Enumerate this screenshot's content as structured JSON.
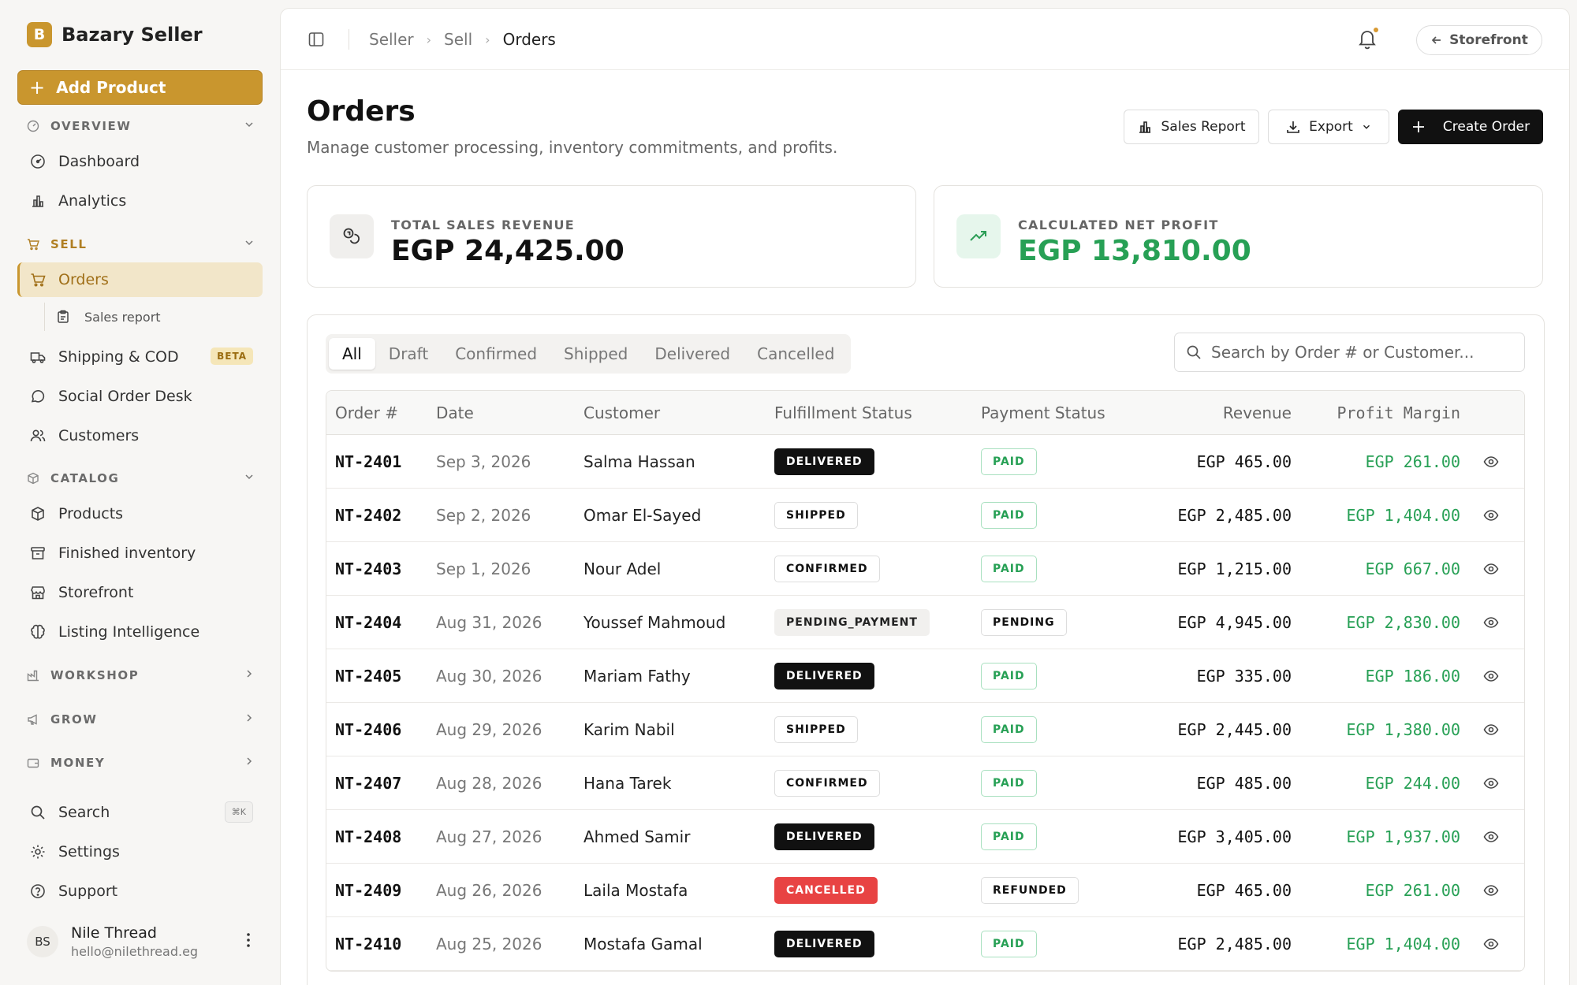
{
  "brand": {
    "logo_letter": "B",
    "name": "Bazary Seller",
    "accent": "#c9962e"
  },
  "sidebar": {
    "add_product": "Add Product",
    "overview": {
      "title": "OVERVIEW",
      "items": [
        "Dashboard",
        "Analytics"
      ]
    },
    "sell": {
      "title": "SELL",
      "orders": "Orders",
      "sales_report": "Sales report",
      "shipping": "Shipping & COD",
      "beta": "BETA",
      "social": "Social Order Desk",
      "customers": "Customers"
    },
    "catalog": {
      "title": "CATALOG",
      "items": [
        "Products",
        "Finished inventory",
        "Storefront",
        "Listing Intelligence"
      ]
    },
    "workshop": "WORKSHOP",
    "grow": "GROW",
    "money": "MONEY",
    "search": "Search",
    "search_kbd": "⌘K",
    "settings": "Settings",
    "support": "Support",
    "user": {
      "initials": "BS",
      "name": "Nile Thread",
      "email": "hello@nilethread.eg"
    }
  },
  "topbar": {
    "crumbs": [
      "Seller",
      "Sell",
      "Orders"
    ],
    "storefront": "Storefront"
  },
  "page": {
    "title": "Orders",
    "subtitle": "Manage customer processing, inventory commitments, and profits.",
    "sales_report": "Sales Report",
    "export": "Export",
    "create_order": "Create Order"
  },
  "stats": {
    "revenue_label": "TOTAL SALES REVENUE",
    "revenue_value": "EGP 24,425.00",
    "profit_label": "CALCULATED NET PROFIT",
    "profit_value": "EGP 13,810.00",
    "profit_color": "#27a055"
  },
  "tabs": [
    "All",
    "Draft",
    "Confirmed",
    "Shipped",
    "Delivered",
    "Cancelled"
  ],
  "search_placeholder": "Search by Order # or Customer...",
  "table": {
    "headers": [
      "Order #",
      "Date",
      "Customer",
      "Fulfillment Status",
      "Payment Status",
      "Revenue",
      "Profit Margin"
    ],
    "rows": [
      [
        "NT-2401",
        "Sep 3, 2026",
        "Salma Hassan",
        "DELIVERED",
        "PAID",
        "EGP 465.00",
        "EGP 261.00"
      ],
      [
        "NT-2402",
        "Sep 2, 2026",
        "Omar El-Sayed",
        "SHIPPED",
        "PAID",
        "EGP 2,485.00",
        "EGP 1,404.00"
      ],
      [
        "NT-2403",
        "Sep 1, 2026",
        "Nour Adel",
        "CONFIRMED",
        "PAID",
        "EGP 1,215.00",
        "EGP 667.00"
      ],
      [
        "NT-2404",
        "Aug 31, 2026",
        "Youssef Mahmoud",
        "PENDING_PAYMENT",
        "PENDING",
        "EGP 4,945.00",
        "EGP 2,830.00"
      ],
      [
        "NT-2405",
        "Aug 30, 2026",
        "Mariam Fathy",
        "DELIVERED",
        "PAID",
        "EGP 335.00",
        "EGP 186.00"
      ],
      [
        "NT-2406",
        "Aug 29, 2026",
        "Karim Nabil",
        "SHIPPED",
        "PAID",
        "EGP 2,445.00",
        "EGP 1,380.00"
      ],
      [
        "NT-2407",
        "Aug 28, 2026",
        "Hana Tarek",
        "CONFIRMED",
        "PAID",
        "EGP 485.00",
        "EGP 244.00"
      ],
      [
        "NT-2408",
        "Aug 27, 2026",
        "Ahmed Samir",
        "DELIVERED",
        "PAID",
        "EGP 3,405.00",
        "EGP 1,937.00"
      ],
      [
        "NT-2409",
        "Aug 26, 2026",
        "Laila Mostafa",
        "CANCELLED",
        "REFUNDED",
        "EGP 465.00",
        "EGP 261.00"
      ],
      [
        "NT-2410",
        "Aug 25, 2026",
        "Mostafa Gamal",
        "DELIVERED",
        "PAID",
        "EGP 2,485.00",
        "EGP 1,404.00"
      ]
    ]
  }
}
